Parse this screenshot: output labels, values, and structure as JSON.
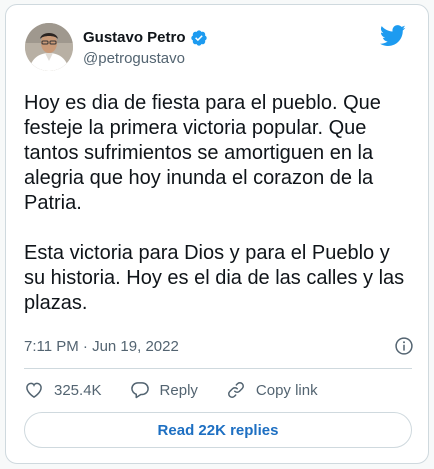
{
  "author": {
    "display_name": "Gustavo Petro",
    "handle": "@petrogustavo"
  },
  "tweet": {
    "text": "Hoy es dia de fiesta para el pueblo. Que festeje la primera victoria popular. Que tantos sufrimientos se amortiguen en la alegria que hoy inunda el corazon de la Patria.\n\nEsta victoria para Dios y para el Pueblo y su historia. Hoy es el dia de las calles y las plazas.",
    "timestamp": "7:11 PM · Jun 19, 2022"
  },
  "actions": {
    "like_count": "325.4K",
    "reply_label": "Reply",
    "copy_link_label": "Copy link"
  },
  "read_replies_label": "Read 22K replies",
  "colors": {
    "brand": "#1d9bf0",
    "link": "#1d6fc2",
    "muted": "#536471",
    "text": "#0f1419"
  }
}
